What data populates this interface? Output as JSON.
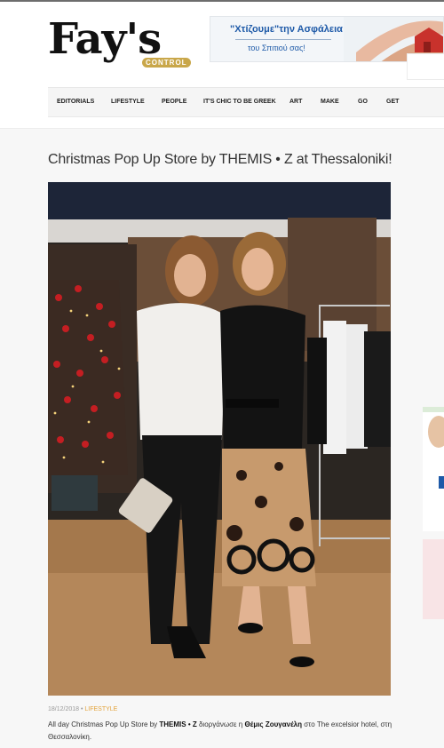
{
  "site": {
    "logo_text": "Fay's",
    "logo_tagline": "CONTROL"
  },
  "ad": {
    "title": "\"Χτίζουμε\"την Ασφάλεια",
    "subtitle": "του Σπιτιού σας!"
  },
  "nav": {
    "items": [
      "EDITORIALS",
      "LIFESTYLE",
      "PEOPLE",
      "IT'S CHIC TO BE GREEK",
      "ART",
      "MAKE",
      "GO",
      "GET"
    ]
  },
  "article": {
    "title": "Christmas Pop Up Store by THEMIS • Z at Thessaloniki!",
    "date": "18/12/2018",
    "separator": " • ",
    "category": "LIFESTYLE",
    "caption": {
      "p1": "All day Christmas Pop Up Store by ",
      "b1": "THEMIS • Z",
      "p2": " διοργάνωσε η ",
      "b2": "Θέμις Ζουγανέλη",
      "p3": " στο The excelsior hotel, στη Θεσσαλονίκη."
    }
  },
  "colors": {
    "accent": "#e3a33b",
    "ad_blue": "#1e5aa8",
    "logo_gold": "#c9a74a"
  }
}
